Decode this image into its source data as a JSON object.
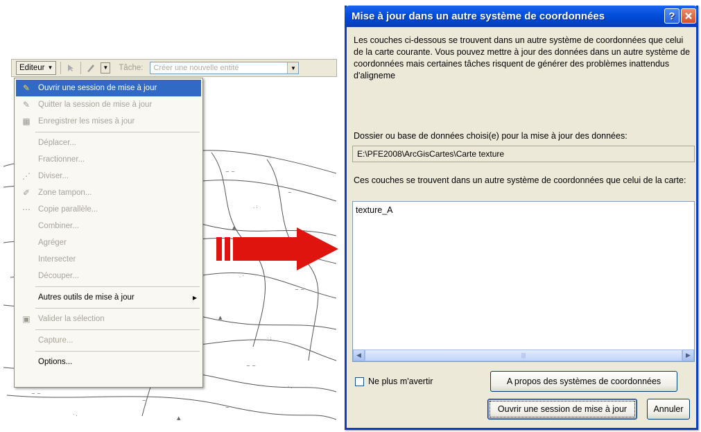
{
  "toolbar": {
    "editor_label": "Editeur",
    "task_label": "Tâche:",
    "task_value": "Créer une nouvelle entité"
  },
  "editor_menu": {
    "items": [
      {
        "label": "Ouvrir une session de mise à jour",
        "icon": "edit-session-icon"
      },
      {
        "label": "Quitter la session de mise à jour",
        "icon": "stop-edit-icon"
      },
      {
        "label": "Enregistrer les mises à jour",
        "icon": "save-edits-icon"
      },
      {
        "label": "Déplacer..."
      },
      {
        "label": "Fractionner..."
      },
      {
        "label": "Diviser...",
        "icon": "divide-icon"
      },
      {
        "label": "Zone tampon...",
        "icon": "buffer-icon"
      },
      {
        "label": "Copie parallèle...",
        "icon": "copy-parallel-icon"
      },
      {
        "label": "Combiner..."
      },
      {
        "label": "Agréger"
      },
      {
        "label": "Intersecter"
      },
      {
        "label": "Découper..."
      },
      {
        "label": "Autres outils de mise à jour"
      },
      {
        "label": "Valider la sélection",
        "icon": "validate-icon"
      },
      {
        "label": "Capture..."
      },
      {
        "label": "Options..."
      }
    ]
  },
  "dialog": {
    "title": "Mise à jour dans un autre système de coordonnées",
    "intro": "Les couches ci-dessous se trouvent dans un autre système de coordonnées que celui de la carte courante. Vous pouvez mettre à jour des données dans un autre système de coordonnées mais certaines tâches risquent de générer des problèmes inattendus d'aligneme",
    "folder_label": "Dossier ou base de données choisi(e) pour la mise à jour des données:",
    "folder_path": "E:\\PFE2008\\ArcGisCartes\\Carte texture",
    "layers_label": "Ces couches se trouvent dans un autre système de coordonnées que celui de la carte:",
    "layers": [
      "texture_A"
    ],
    "checkbox_label": "Ne plus m'avertir",
    "about_button": "A propos des systèmes de coordonnées",
    "open_button": "Ouvrir une session de mise à jour",
    "cancel_button": "Annuler"
  },
  "colors": {
    "titlebar": "#0450dc",
    "menu_highlight": "#316ac5",
    "arrow": "#e0140e"
  }
}
